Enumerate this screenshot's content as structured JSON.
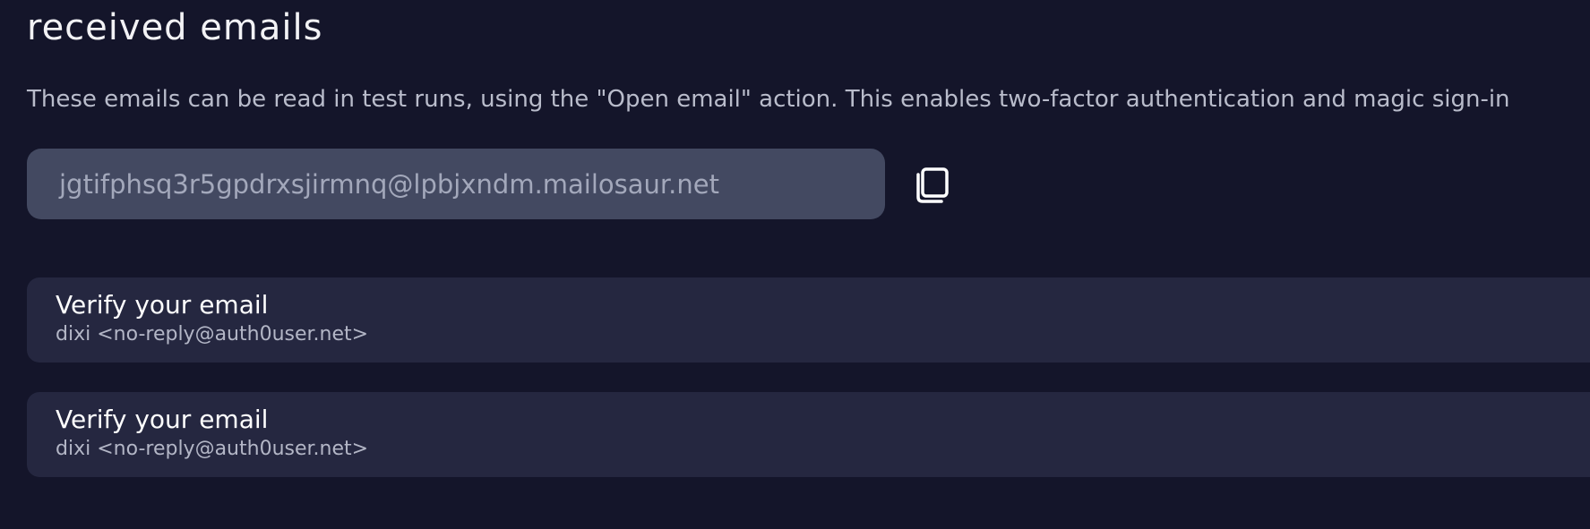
{
  "section": {
    "title": "received emails",
    "description": "These emails can be read in test runs, using the \"Open email\" action. This enables two-factor authentication and magic sign-in"
  },
  "inbox": {
    "address": "jgtifphsq3r5gpdrxsjirmnq@lpbjxndm.mailosaur.net",
    "copy_icon": "copy-icon"
  },
  "emails": [
    {
      "subject": "Verify your email",
      "sender": "dixi <no-reply@auth0user.net>"
    },
    {
      "subject": "Verify your email",
      "sender": "dixi <no-reply@auth0user.net>"
    }
  ],
  "colors": {
    "background": "#14152a",
    "field_background": "#434961",
    "row_background": "#252740",
    "muted_text": "#b9bccb"
  }
}
